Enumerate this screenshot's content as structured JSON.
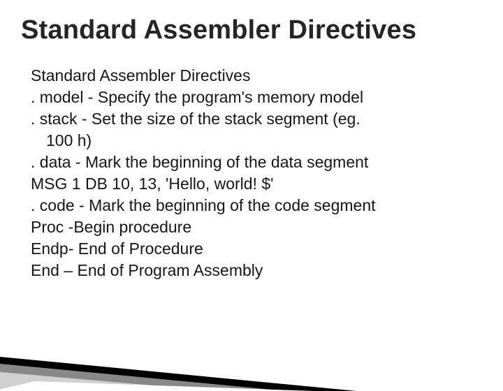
{
  "title": "Standard Assembler Directives",
  "lines": {
    "l0": "Standard Assembler Directives",
    "l1": ". model - Specify the program's memory model",
    "l2": ". stack - Set the size of the stack segment (eg.",
    "l2w": "100 h)",
    "l3": ". data - Mark the beginning of the data segment",
    "l4": "MSG 1 DB 10, 13, 'Hello, world! $'",
    "l5": ". code - Mark the beginning of the code segment",
    "l6": " Proc -Begin procedure",
    "l7": "Endp- End of Procedure",
    "l8": "End – End of Program Assembly"
  }
}
